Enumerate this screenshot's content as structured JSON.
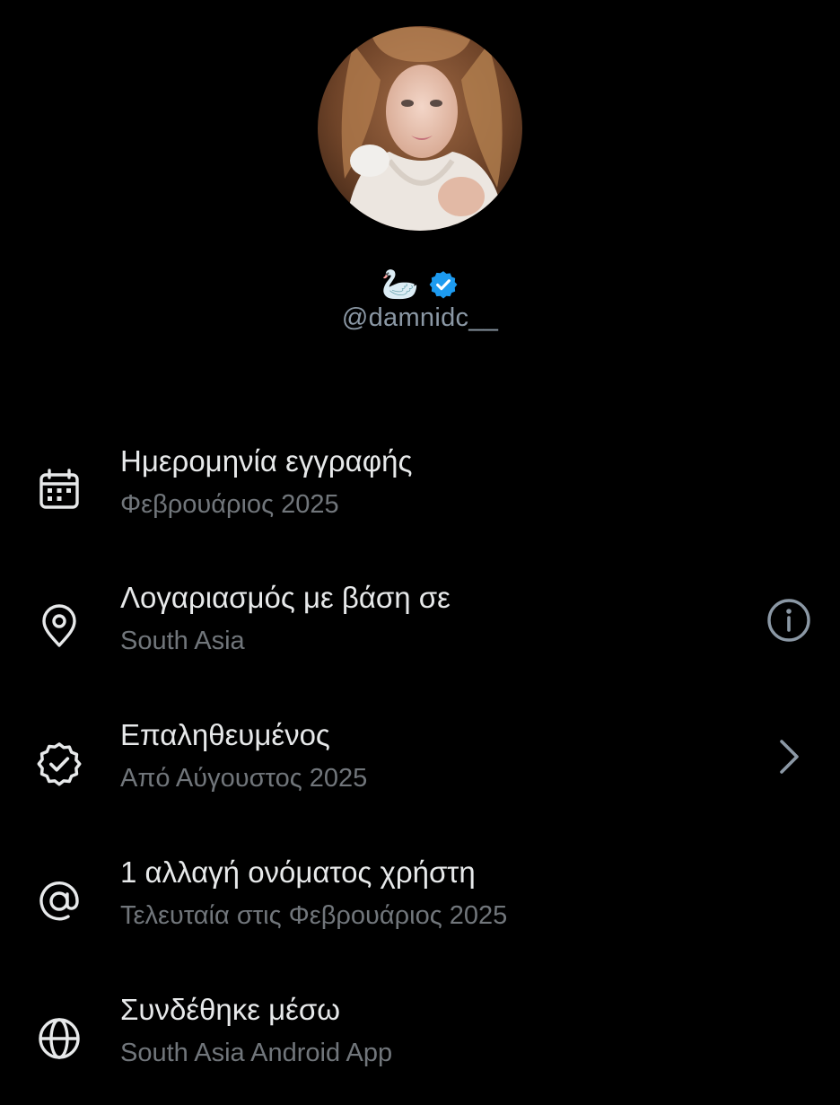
{
  "profile": {
    "display_name_emoji": "🦢",
    "handle": "@damnidc__",
    "verified_color": "#1d9bf0"
  },
  "details": [
    {
      "icon": "calendar-icon",
      "title": "Ημερομηνία εγγραφής",
      "subtitle": "Φεβρουάριος 2025"
    },
    {
      "icon": "location-pin-icon",
      "title": "Λογαριασμός με βάση σε",
      "subtitle": "South Asia",
      "action_icon": "info-icon"
    },
    {
      "icon": "verified-badge-icon",
      "title": "Επαληθευμένος",
      "subtitle": "Από Αύγουστος 2025",
      "action_icon": "chevron-right-icon"
    },
    {
      "icon": "at-sign-icon",
      "title": "1 αλλαγή ονόματος χρήστη",
      "subtitle": "Τελευταία στις Φεβρουάριος 2025"
    },
    {
      "icon": "globe-icon",
      "title": "Συνδέθηκε μέσω",
      "subtitle": "South Asia Android App"
    }
  ],
  "colors": {
    "background": "#000000",
    "primary_text": "#e7e9ea",
    "secondary_text": "#71767b",
    "handle_text": "#8b98a5",
    "icon": "#e7e9ea",
    "action_icon": "#8b98a5"
  }
}
